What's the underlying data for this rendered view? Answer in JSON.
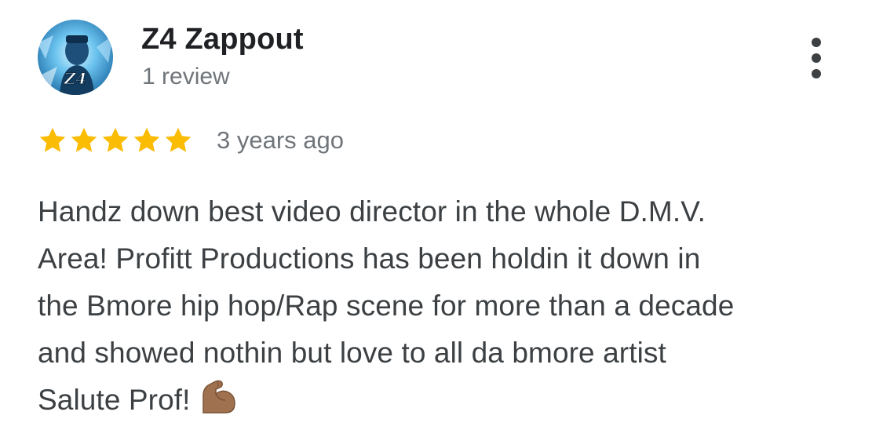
{
  "review": {
    "author_name": "Z4 Zappout",
    "review_count": "1 review",
    "avatar_icon": "profile-photo",
    "avatar_monogram": "Z4",
    "rating": 5,
    "rating_max": 5,
    "timestamp": "3 years ago",
    "more_icon": "more-vertical-icon",
    "text_lines": [
      "Handz down best video director in the whole D.M.V.",
      "Area! Profitt Productions has been holdin it down in",
      "the Bmore hip hop/Rap scene for more than a decade",
      "and showed nothin but love to all da bmore artist",
      "Salute Prof!"
    ],
    "emoji": "flexed-biceps-medium-skin-tone"
  },
  "colors": {
    "star": "#fbbc04",
    "text": "#3c4043",
    "name": "#202124",
    "secondary": "#70757a"
  }
}
